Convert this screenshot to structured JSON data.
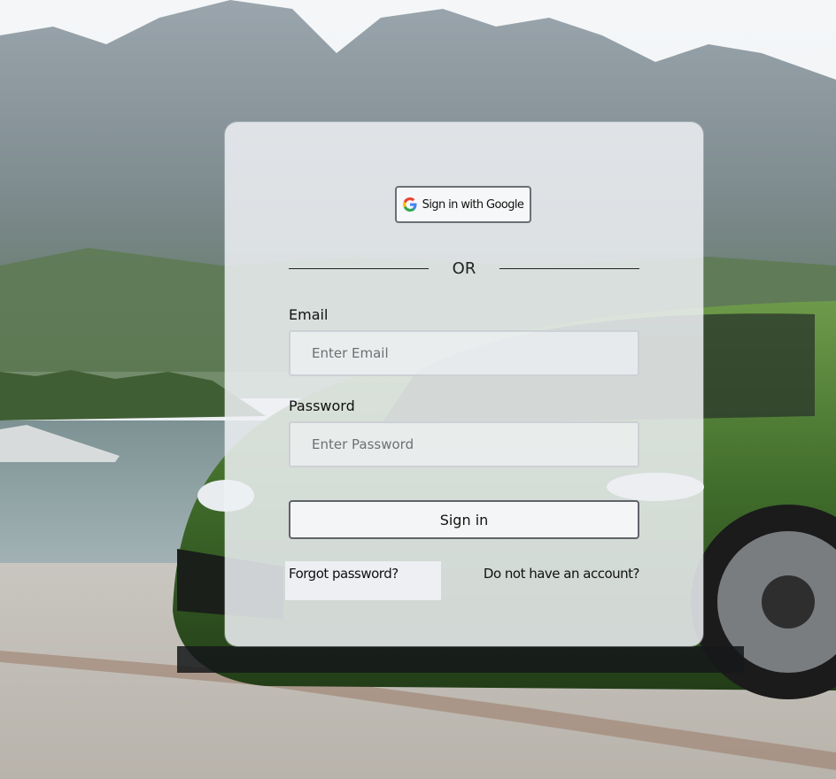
{
  "google": {
    "label": "Sign in with Google"
  },
  "divider": {
    "text": "OR"
  },
  "email": {
    "label": "Email",
    "placeholder": "Enter Email",
    "value": ""
  },
  "password": {
    "label": "Password",
    "placeholder": "Enter Password",
    "value": ""
  },
  "signin": {
    "label": "Sign in"
  },
  "links": {
    "forgot": "Forgot password?",
    "signup": "Do not have an account?"
  },
  "colors": {
    "card": "#eef0f3",
    "border": "#5f636a",
    "car_green": "#3f6b2a"
  }
}
